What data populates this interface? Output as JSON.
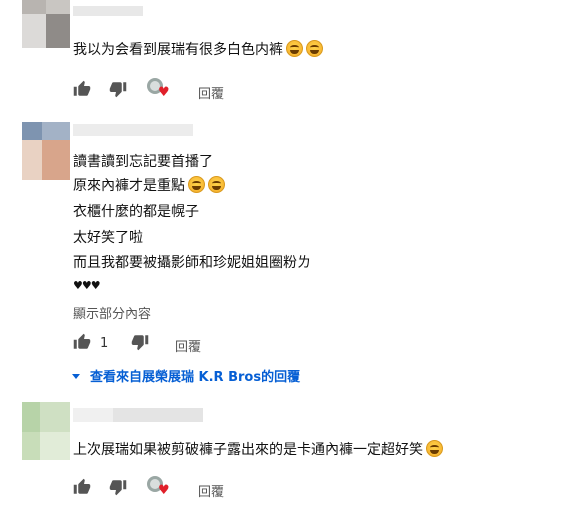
{
  "icons": {
    "like": "thumb-up-icon",
    "dislike": "thumb-down-icon",
    "creator_heart": "creator-heart-icon",
    "emoji": "grinning-emoji-icon",
    "expand": "chevron-down-icon"
  },
  "colors": {
    "link": "#065fd4",
    "heart": "#e0202a",
    "icon": "#555555"
  },
  "comments": [
    {
      "lines": [
        "我以为会看到展瑞有很多白色内裤"
      ],
      "emoji_count": 2,
      "reply_label": "回覆"
    },
    {
      "lines": [
        "讀書讀到忘記要首播了",
        "原來內褲才是重點",
        "衣櫃什麼的都是幌子",
        "太好笑了啦",
        "而且我都要被攝影師和珍妮姐姐圈粉ㄌ",
        "♥♥♥"
      ],
      "show_more": "顯示部分內容",
      "like_count": "1",
      "reply_label": "回覆",
      "view_replies": "查看來自展榮展瑞 K.R Bros的回覆"
    },
    {
      "lines": [
        "上次展瑞如果被剪破褲子露出來的是卡通內褲一定超好笑"
      ],
      "reply_label": "回覆"
    }
  ]
}
